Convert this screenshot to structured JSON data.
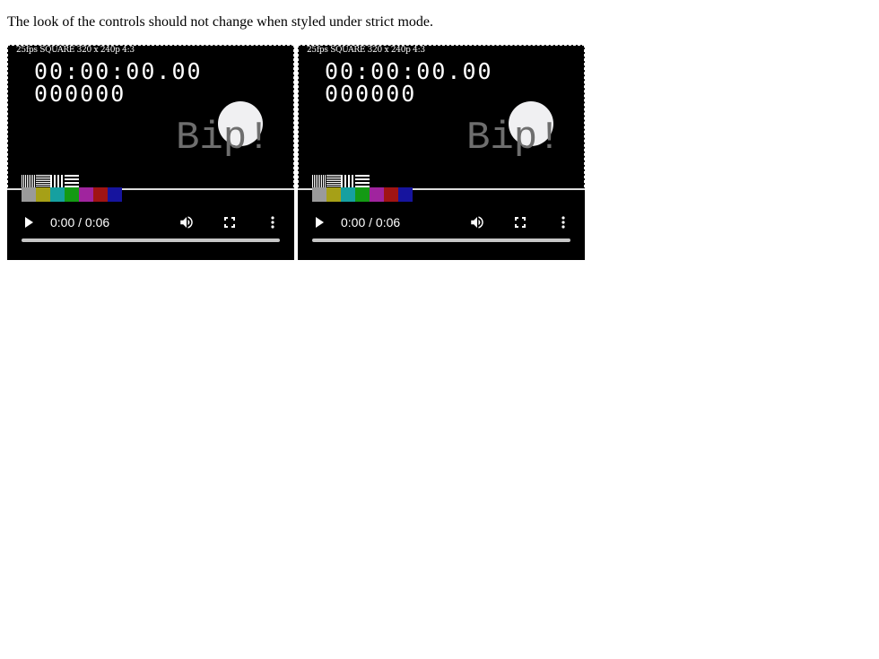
{
  "page": {
    "intro_text": "The look of the controls should not change when styled under strict mode."
  },
  "players": [
    {
      "video": {
        "format_label": "25fps SQUARE 320 x 240p 4:3",
        "timecode": "00:00:00.00",
        "frame_counter": "000000",
        "bip_text": "Bip!",
        "color_bars": [
          "#9a9a9a",
          "#a6a017",
          "#16a0a0",
          "#149a14",
          "#a0249e",
          "#a01414",
          "#16149e"
        ]
      },
      "controls": {
        "play_icon": "play-icon",
        "time_display": "0:00 / 0:06",
        "volume_icon": "volume-icon",
        "fullscreen_icon": "fullscreen-icon",
        "more_icon": "more-options-icon",
        "progress": 0
      }
    },
    {
      "video": {
        "format_label": "25fps SQUARE 320 x 240p 4:3",
        "timecode": "00:00:00.00",
        "frame_counter": "000000",
        "bip_text": "Bip!",
        "color_bars": [
          "#9a9a9a",
          "#a6a017",
          "#16a0a0",
          "#149a14",
          "#a0249e",
          "#a01414",
          "#16149e"
        ]
      },
      "controls": {
        "play_icon": "play-icon",
        "time_display": "0:00 / 0:06",
        "volume_icon": "volume-icon",
        "fullscreen_icon": "fullscreen-icon",
        "more_icon": "more-options-icon",
        "progress": 0
      }
    }
  ]
}
